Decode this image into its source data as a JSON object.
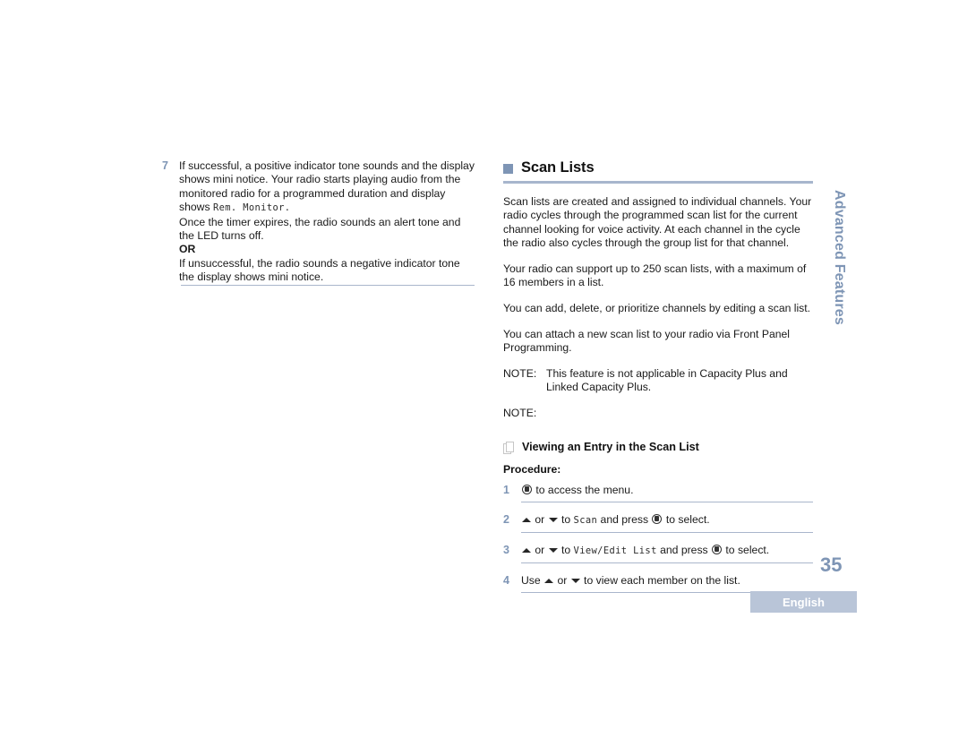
{
  "left_column": {
    "step": {
      "number": "7",
      "lines": [
        "If successful, a positive indicator tone sounds and the display shows mini notice. Your radio starts playing audio from the monitored radio for a programmed duration and display shows ",
        "Once the timer expires, the radio sounds an alert tone and the LED turns off.",
        "If unsuccessful, the radio sounds a negative indicator tone the display shows mini notice."
      ],
      "display_value": "Rem. Monitor.",
      "or_label": "OR"
    }
  },
  "right_column": {
    "heading": "Scan Lists",
    "paragraphs": [
      "Scan lists are created and assigned to individual channels. Your radio cycles through the programmed scan list for the current channel looking for voice activity. At each channel in the cycle the radio also cycles through the group list for that channel.",
      "Your radio can support up to 250 scan lists, with a maximum of 16 members in a list.",
      "You can add, delete, or prioritize channels by editing a scan list.",
      "You can attach a new scan list to your radio via Front Panel Programming."
    ],
    "notes": [
      {
        "label": "NOTE:",
        "text": "This feature is not applicable in Capacity Plus and Linked Capacity Plus."
      },
      {
        "label": "NOTE:",
        "text": ""
      }
    ],
    "subheading": "Viewing an Entry in the Scan List",
    "procedure_label": "Procedure:",
    "procedure": [
      {
        "number": "1",
        "parts": [
          {
            "type": "icon",
            "icon": "menu-button-icon"
          },
          {
            "type": "text",
            "text": " to access the menu."
          }
        ]
      },
      {
        "number": "2",
        "parts": [
          {
            "type": "icon",
            "icon": "arrow-up-icon"
          },
          {
            "type": "text",
            "text": " or "
          },
          {
            "type": "icon",
            "icon": "arrow-down-icon"
          },
          {
            "type": "text",
            "text": " to "
          },
          {
            "type": "mono",
            "text": "Scan"
          },
          {
            "type": "text",
            "text": " and press "
          },
          {
            "type": "icon",
            "icon": "menu-button-icon"
          },
          {
            "type": "text",
            "text": " to select."
          }
        ]
      },
      {
        "number": "3",
        "parts": [
          {
            "type": "icon",
            "icon": "arrow-up-icon"
          },
          {
            "type": "text",
            "text": " or "
          },
          {
            "type": "icon",
            "icon": "arrow-down-icon"
          },
          {
            "type": "text",
            "text": " to "
          },
          {
            "type": "mono",
            "text": "View/Edit List"
          },
          {
            "type": "text",
            "text": " and press "
          },
          {
            "type": "icon",
            "icon": "menu-button-icon"
          },
          {
            "type": "text",
            "text": " to select."
          }
        ]
      },
      {
        "number": "4",
        "parts": [
          {
            "type": "text",
            "text": "Use "
          },
          {
            "type": "icon",
            "icon": "arrow-up-icon"
          },
          {
            "type": "text",
            "text": " or "
          },
          {
            "type": "icon",
            "icon": "arrow-down-icon"
          },
          {
            "type": "text",
            "text": " to view each member on the list."
          }
        ]
      }
    ]
  },
  "side_tab": "Advanced Features",
  "footer": {
    "page_number": "35",
    "language": "English"
  },
  "colors": {
    "accent": "#7e95b5",
    "rule": "#aab6cc",
    "heading_rule": "#a7b6cd",
    "badge_bg": "#b9c5d8"
  }
}
